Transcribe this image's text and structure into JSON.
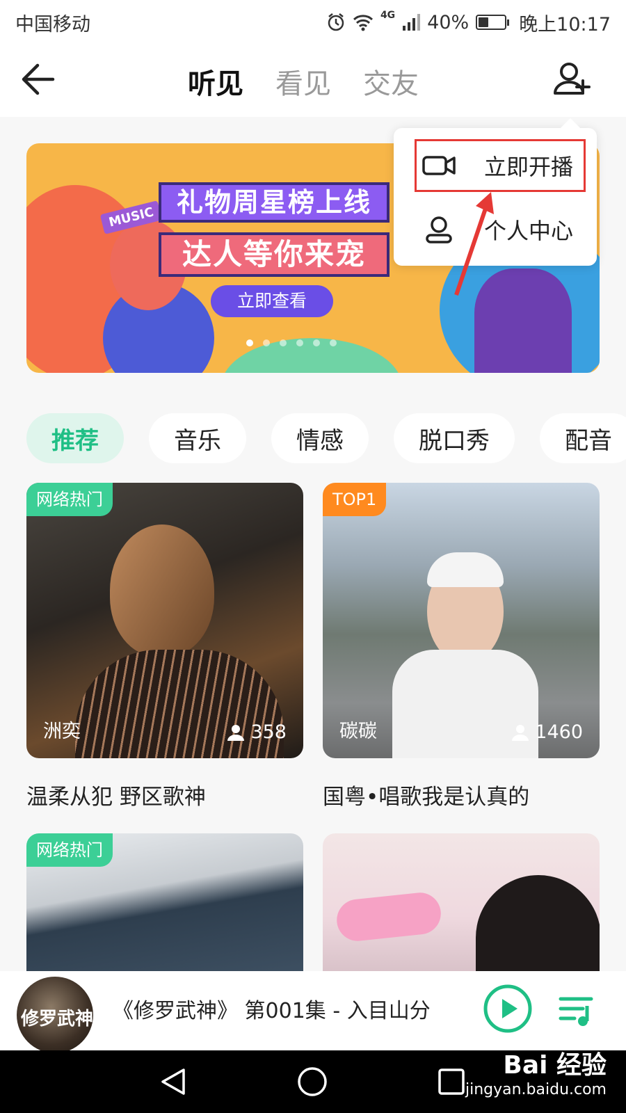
{
  "status_bar": {
    "carrier": "中国移动",
    "network": "4G",
    "battery_text": "40%",
    "battery_level": 0.4,
    "time": "晚上10:17"
  },
  "header": {
    "tabs": [
      {
        "label": "听见",
        "active": true
      },
      {
        "label": "看见",
        "active": false
      },
      {
        "label": "交友",
        "active": false
      }
    ]
  },
  "banner": {
    "sign_text": "MUSIC",
    "title_line1": "礼物周星榜上线",
    "title_line2": "达人等你来宠",
    "button_label": "立即查看",
    "dot_count": 6,
    "active_dot": 0
  },
  "popup_menu": {
    "items": [
      {
        "label": "立即开播",
        "icon": "video-camera-icon"
      },
      {
        "label": "个人中心",
        "icon": "user-icon"
      }
    ]
  },
  "categories": [
    {
      "label": "推荐",
      "active": true
    },
    {
      "label": "音乐",
      "active": false
    },
    {
      "label": "情感",
      "active": false
    },
    {
      "label": "脱口秀",
      "active": false
    },
    {
      "label": "配音",
      "active": false
    }
  ],
  "cards": [
    {
      "tag": "网络热门",
      "name": "洲奕",
      "listeners": "358",
      "title": "温柔从犯 野区歌神"
    },
    {
      "tag": "TOP1",
      "name": "碳碳",
      "listeners": "1460",
      "title": "国粤•唱歌我是认真的"
    },
    {
      "tag": "网络热门"
    },
    {
      "tag": ""
    }
  ],
  "player": {
    "cover_text": "修罗武神",
    "track": "《修罗武神》 第001集 - 入目山分"
  },
  "watermark": {
    "main": "Bai 经验",
    "sub": "jingyan.baidu.com"
  },
  "colors": {
    "accent": "#1fbf85",
    "chip_active_bg": "#dff5ec",
    "tag_green": "#3ccf96",
    "tag_orange": "#ff8a1f",
    "highlight": "#e53935"
  }
}
